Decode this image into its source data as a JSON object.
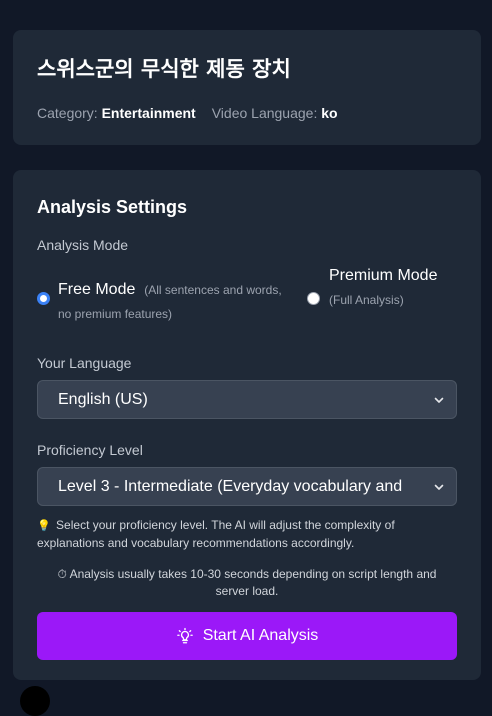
{
  "video": {
    "title": "스위스군의 무식한 제동 장치",
    "category_label": "Category:",
    "category_value": "Entertainment",
    "language_label": "Video Language:",
    "language_value": "ko"
  },
  "settings": {
    "title": "Analysis Settings",
    "mode_label": "Analysis Mode",
    "modes": [
      {
        "name": "Free Mode",
        "desc": "(All sentences and words, no premium features)",
        "selected": true
      },
      {
        "name": "Premium Mode",
        "desc": "(Full Analysis)",
        "selected": false
      }
    ],
    "language_label": "Your Language",
    "language_value": "English (US)",
    "proficiency_label": "Proficiency Level",
    "proficiency_value": "Level 3 - Intermediate (Everyday vocabulary and",
    "hint_icon": "lightbulb-emoji",
    "hint_text": "Select your proficiency level. The AI will adjust the complexity of explanations and vocabulary recommendations accordingly.",
    "note_icon": "stopwatch-emoji",
    "note_text": "Analysis usually takes 10-30 seconds depending on script length and server load.",
    "start_label": "Start AI Analysis",
    "start_icon": "lightbulb-icon",
    "colors": {
      "accent": "#9b18f8",
      "radio": "#3b82f6",
      "card": "#1f2937",
      "background": "#111827"
    }
  }
}
